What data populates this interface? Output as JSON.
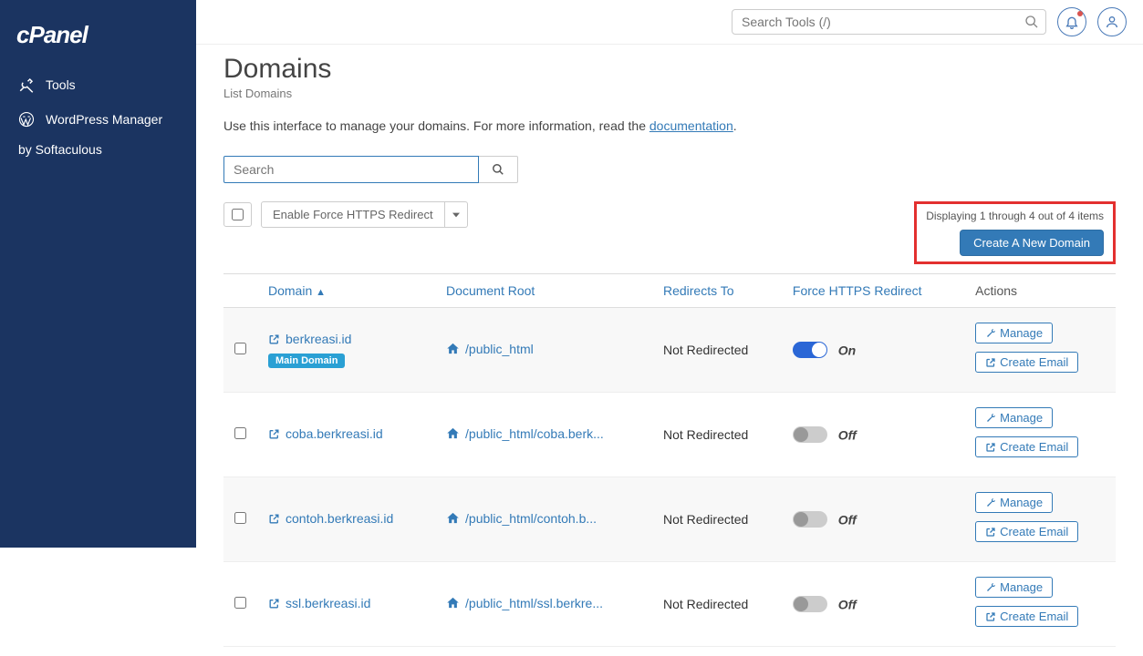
{
  "sidebar": {
    "items": [
      {
        "label": "Tools"
      },
      {
        "label": "WordPress Manager"
      }
    ],
    "subtext": "by Softaculous"
  },
  "topbar": {
    "search_placeholder": "Search Tools (/)"
  },
  "page": {
    "title": "Domains",
    "subtitle": "List Domains",
    "desc_pre": "Use this interface to manage your domains. For more information, read the ",
    "desc_link": "documentation",
    "desc_post": "."
  },
  "search": {
    "placeholder": "Search"
  },
  "toolbar": {
    "enable_https": "Enable Force HTTPS Redirect",
    "display_text": "Displaying 1 through 4 out of 4 items",
    "create_btn": "Create A New Domain"
  },
  "headers": {
    "domain": "Domain",
    "doc_root": "Document Root",
    "redirects": "Redirects To",
    "https": "Force HTTPS Redirect",
    "actions": "Actions"
  },
  "badge": {
    "main_domain": "Main Domain"
  },
  "actions": {
    "manage": "Manage",
    "create_email": "Create Email"
  },
  "rows": [
    {
      "domain": "berkreasi.id",
      "doc_root": "/public_html",
      "redirects": "Not Redirected",
      "https_on": true,
      "https_label": "On",
      "main": true
    },
    {
      "domain": "coba.berkreasi.id",
      "doc_root": "/public_html/coba.berk...",
      "redirects": "Not Redirected",
      "https_on": false,
      "https_label": "Off",
      "main": false
    },
    {
      "domain": "contoh.berkreasi.id",
      "doc_root": "/public_html/contoh.b...",
      "redirects": "Not Redirected",
      "https_on": false,
      "https_label": "Off",
      "main": false
    },
    {
      "domain": "ssl.berkreasi.id",
      "doc_root": "/public_html/ssl.berkre...",
      "redirects": "Not Redirected",
      "https_on": false,
      "https_label": "Off",
      "main": false
    }
  ]
}
